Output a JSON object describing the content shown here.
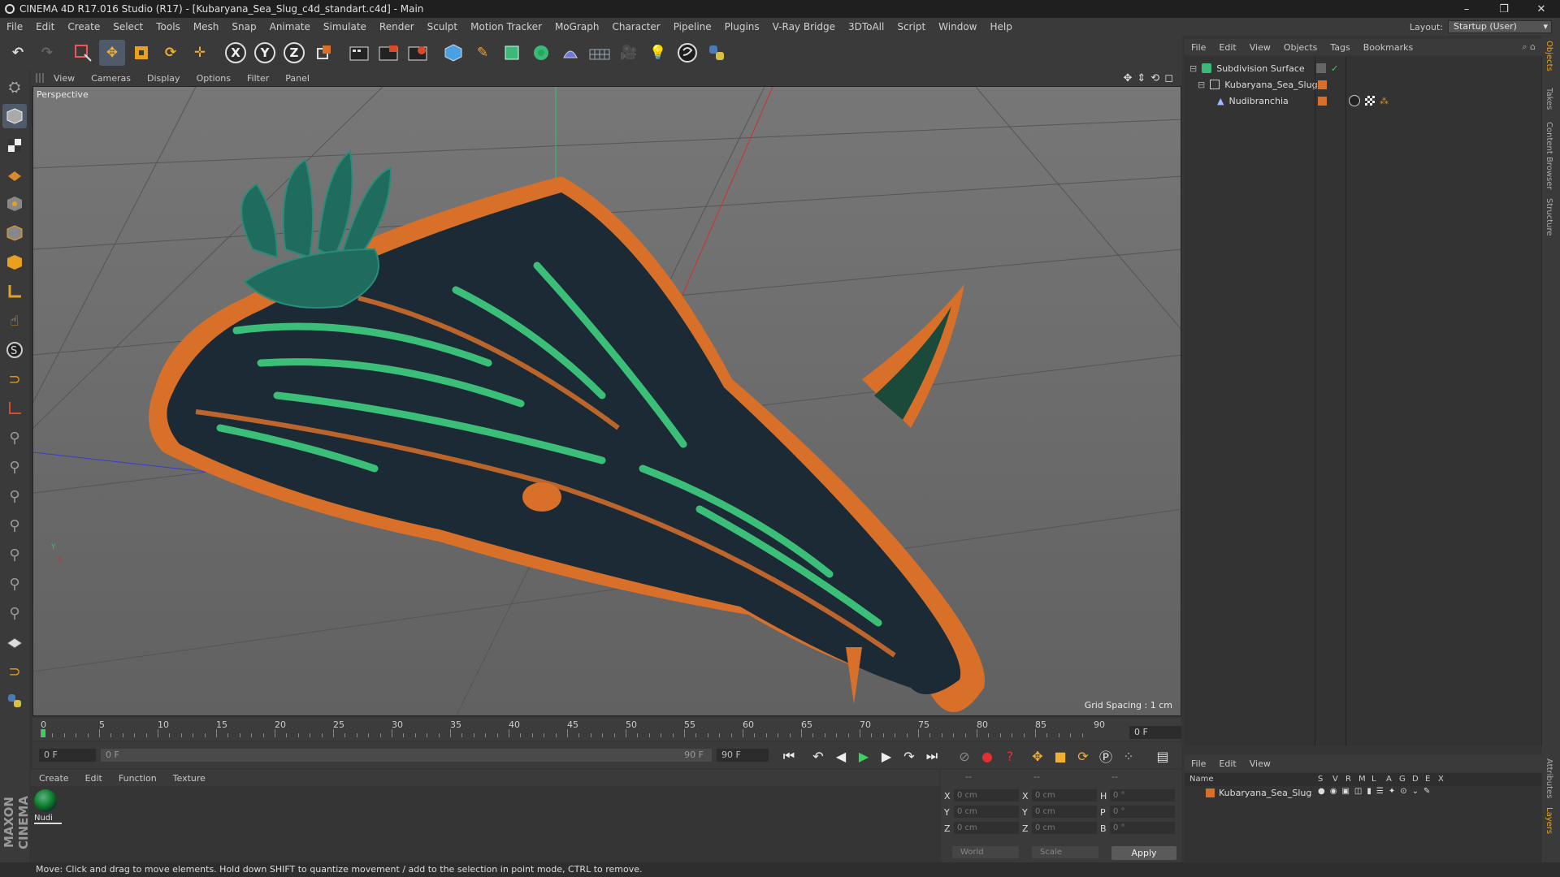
{
  "window": {
    "title": "CINEMA 4D R17.016 Studio (R17) - [Kubaryana_Sea_Slug_c4d_standart.c4d] - Main",
    "min": "–",
    "max": "❐",
    "close": "✕"
  },
  "menu": [
    "File",
    "Edit",
    "Create",
    "Select",
    "Tools",
    "Mesh",
    "Snap",
    "Animate",
    "Simulate",
    "Render",
    "Sculpt",
    "Motion Tracker",
    "MoGraph",
    "Character",
    "Pipeline",
    "Plugins",
    "V-Ray Bridge",
    "3DToAll",
    "Script",
    "Window",
    "Help"
  ],
  "layout": {
    "label": "Layout:",
    "value": "Startup (User)"
  },
  "toolbar": {
    "x": "X",
    "y": "Y",
    "z": "Z"
  },
  "viewport": {
    "menu": [
      "View",
      "Cameras",
      "Display",
      "Options",
      "Filter",
      "Panel"
    ],
    "label": "Perspective",
    "grid_spacing": "Grid Spacing : 1 cm",
    "axis_y": "Y",
    "axis_x": "X"
  },
  "timeline": {
    "ticks": [
      "0",
      "5",
      "10",
      "15",
      "20",
      "25",
      "30",
      "35",
      "40",
      "45",
      "50",
      "55",
      "60",
      "65",
      "70",
      "75",
      "80",
      "85",
      "90"
    ],
    "frame_field": "0 F"
  },
  "playback": {
    "start": "0 F",
    "range_start": "0 F",
    "range_end": "90 F",
    "end": "90 F"
  },
  "material_manager": {
    "menu": [
      "Create",
      "Edit",
      "Function",
      "Texture"
    ],
    "material_name": "Nudi"
  },
  "coordinates": {
    "header": [
      "--",
      "--",
      "--"
    ],
    "rows": [
      {
        "axis": "X",
        "pos": "0 cm",
        "axis2": "X",
        "size": "0 cm",
        "rot_axis": "H",
        "rot": "0 °"
      },
      {
        "axis": "Y",
        "pos": "0 cm",
        "axis2": "Y",
        "size": "0 cm",
        "rot_axis": "P",
        "rot": "0 °"
      },
      {
        "axis": "Z",
        "pos": "0 cm",
        "axis2": "Z",
        "size": "0 cm",
        "rot_axis": "B",
        "rot": "0 °"
      }
    ],
    "mode1": "World",
    "mode2": "Scale",
    "apply": "Apply"
  },
  "object_manager": {
    "menu": [
      "File",
      "Edit",
      "View",
      "Objects",
      "Tags",
      "Bookmarks"
    ],
    "objects": [
      "Subdivision Surface",
      "Kubaryana_Sea_Slug",
      "Nudibranchia"
    ]
  },
  "layer_manager": {
    "menu": [
      "File",
      "Edit",
      "View"
    ],
    "columns": [
      "Name",
      "S",
      "V",
      "R",
      "M",
      "L",
      "A",
      "G",
      "D",
      "E",
      "X"
    ],
    "layer": "Kubaryana_Sea_Slug"
  },
  "right_tabs": [
    "Objects",
    "Takes",
    "Content Browser",
    "Structure",
    "Attributes",
    "Layers"
  ],
  "brand": "MAXON CINEMA 4D",
  "status": "Move: Click and drag to move elements. Hold down SHIFT to quantize movement / add to the selection in point mode, CTRL to remove.",
  "colors": {
    "accent_orange": "#d9702a",
    "model_teal": "#1f6b5e",
    "model_green": "#39c27a"
  }
}
